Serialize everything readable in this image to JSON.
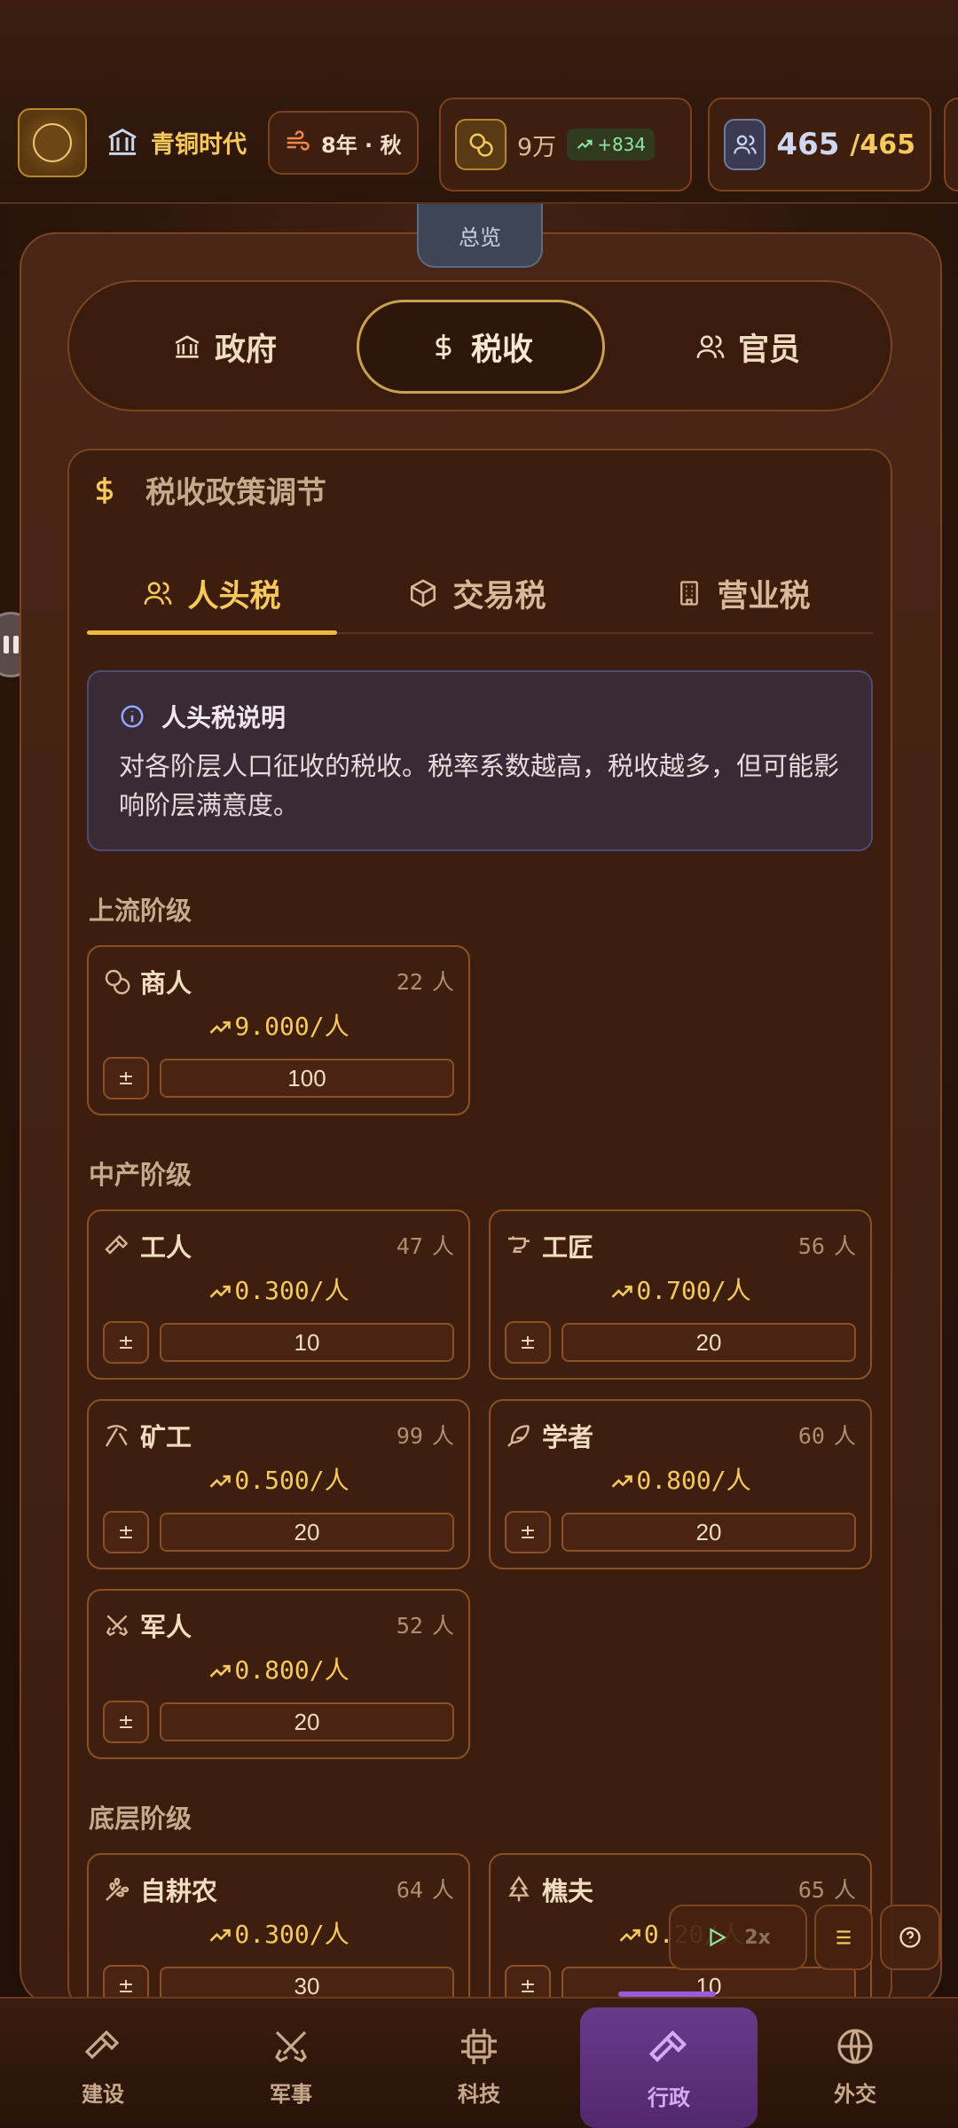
{
  "header": {
    "era": "青铜时代",
    "date": "8年 · 秋",
    "money": "9万",
    "money_delta": "+834",
    "population_current": "465",
    "population_max": "/465"
  },
  "overview_tab": "总览",
  "segments": [
    {
      "label": "政府",
      "icon": "bank-icon"
    },
    {
      "label": "税收",
      "icon": "dollar-icon"
    },
    {
      "label": "官员",
      "icon": "users-icon"
    }
  ],
  "tax_card": {
    "title": "税收政策调节",
    "subtabs": [
      {
        "label": "人头税",
        "icon": "users-icon"
      },
      {
        "label": "交易税",
        "icon": "box-icon"
      },
      {
        "label": "营业税",
        "icon": "building-icon"
      }
    ],
    "info": {
      "title": "人头税说明",
      "text": "对各阶层人口征收的税收。税率系数越高，税收越多，但可能影响阶层满意度。"
    }
  },
  "sections": {
    "upper": "上流阶级",
    "middle": "中产阶级",
    "lower": "底层阶级"
  },
  "classes": [
    {
      "name": "商人",
      "count": "22",
      "unit": "人",
      "rate": "9.000/人",
      "value": "100",
      "pm": "±"
    },
    {
      "name": "工人",
      "count": "47",
      "unit": "人",
      "rate": "0.300/人",
      "value": "10",
      "pm": "±"
    },
    {
      "name": "工匠",
      "count": "56",
      "unit": "人",
      "rate": "0.700/人",
      "value": "20",
      "pm": "±"
    },
    {
      "name": "矿工",
      "count": "99",
      "unit": "人",
      "rate": "0.500/人",
      "value": "20",
      "pm": "±"
    },
    {
      "name": "学者",
      "count": "60",
      "unit": "人",
      "rate": "0.800/人",
      "value": "20",
      "pm": "±"
    },
    {
      "name": "军人",
      "count": "52",
      "unit": "人",
      "rate": "0.800/人",
      "value": "20",
      "pm": "±"
    },
    {
      "name": "自耕农",
      "count": "64",
      "unit": "人",
      "rate": "0.300/人",
      "value": "30",
      "pm": "±"
    },
    {
      "name": "樵夫",
      "count": "65",
      "unit": "人",
      "rate": "0.20/人",
      "value": "10",
      "pm": "±"
    }
  ],
  "controls": {
    "speed": "2x"
  },
  "nav": [
    {
      "label": "建设",
      "icon": "hammer-icon"
    },
    {
      "label": "军事",
      "icon": "swords-icon"
    },
    {
      "label": "科技",
      "icon": "chip-icon"
    },
    {
      "label": "行政",
      "icon": "gavel-icon"
    },
    {
      "label": "外交",
      "icon": "globe-icon"
    }
  ],
  "colors": {
    "accent_gold": "#f6c95c",
    "active_nav": "#6a3a8a",
    "positive": "#8ee6a0"
  }
}
